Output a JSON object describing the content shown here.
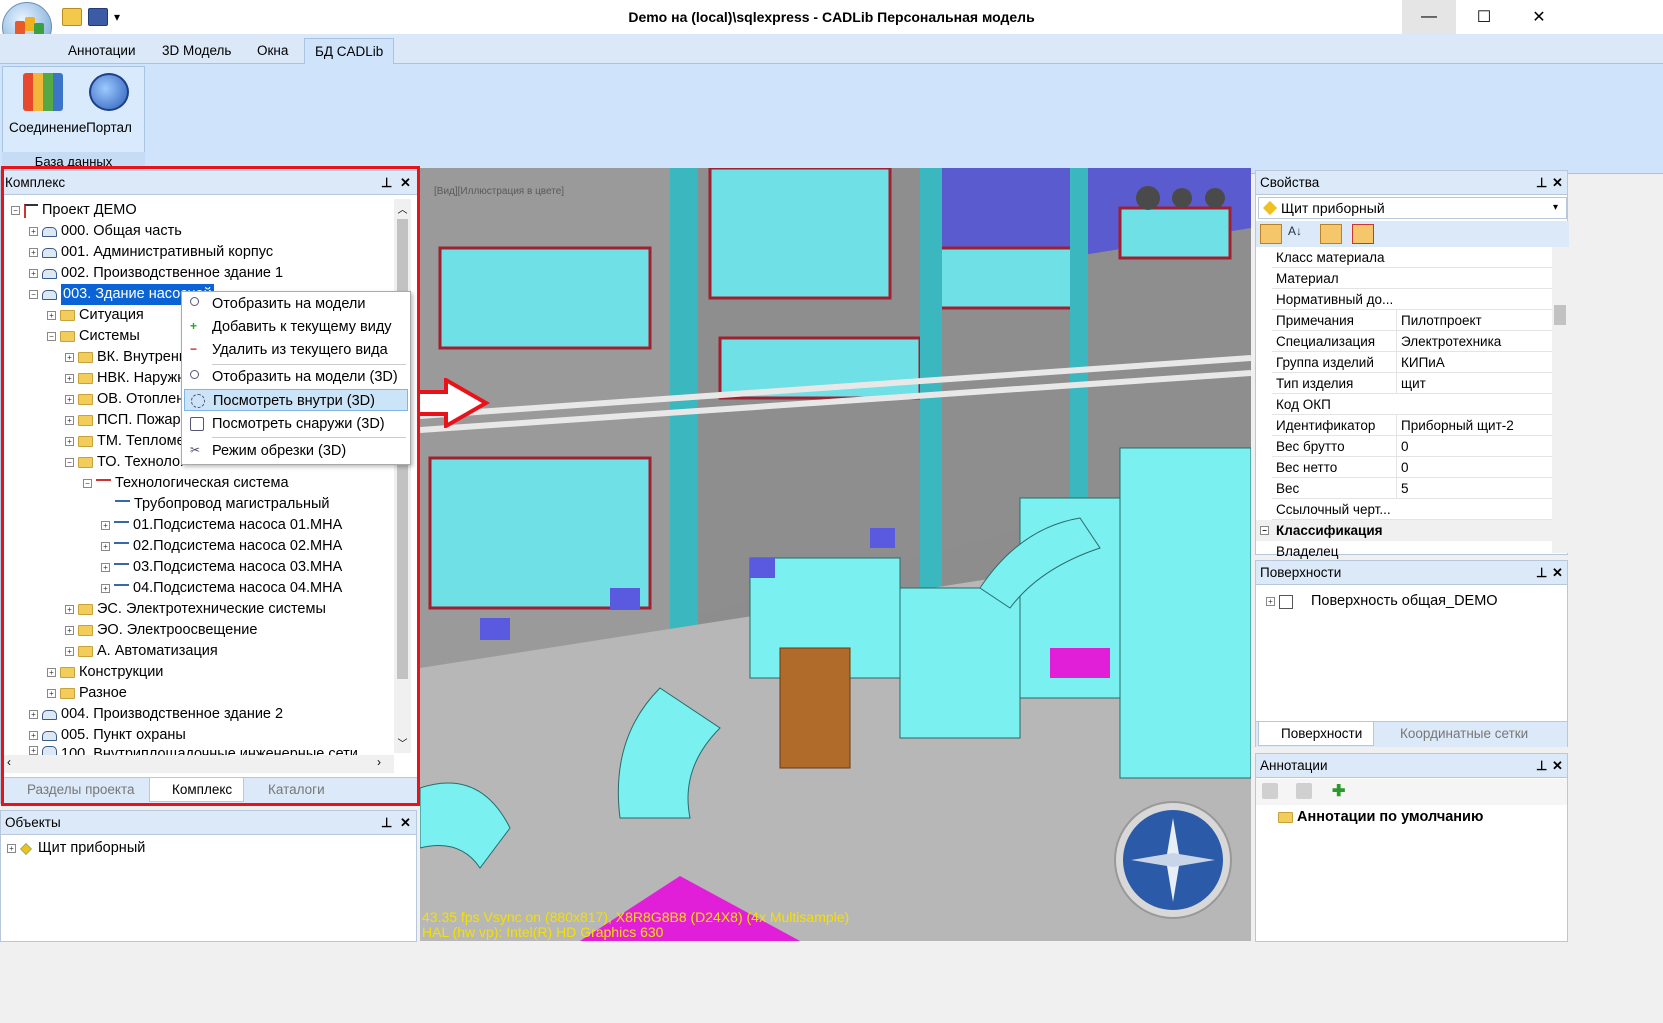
{
  "window": {
    "title": "Demo на (local)\\sqlexpress - CADLib Персональная модель",
    "minimize_glyph": "—",
    "maximize_glyph": "☐",
    "close_glyph": "✕"
  },
  "quick_access": {
    "dropdown_glyph": "▾"
  },
  "ribbon": {
    "tabs": [
      "Аннотации",
      "3D Модель",
      "Окна",
      "БД CADLib"
    ],
    "active_tab": "БД CADLib",
    "group_label": "База данных",
    "buttons": [
      "Соединение",
      "Портал"
    ]
  },
  "complex_panel": {
    "title": "Комплекс",
    "tree": [
      "Проект ДЕМО",
      "000. Общая часть",
      "001. Административный корпус",
      "002. Производственное здание 1",
      "003. Здание насосной",
      "Ситуация",
      "Системы",
      "ВК. Внутренн",
      "НВК. Наружн",
      "ОВ. Отоплен",
      "ПСП. Пожар",
      "ТМ. Тепломе",
      "ТО. Технолог",
      "Технологическая система",
      "Трубопровод магистральный",
      "01.Подсистема насоса 01.МНА",
      "02.Подсистема насоса 02.МНА",
      "03.Подсистема насоса 03.МНА",
      "04.Подсистема насоса 04.МНА",
      "ЭС. Электротехнические системы",
      "ЭО. Электроосвещение",
      "А. Автоматизация",
      "Конструкции",
      "Разное",
      "004. Производственное здание 2",
      "005. Пункт охраны",
      "100. Внутриплощадочные инженерные сети"
    ],
    "bottom_tabs": [
      "Разделы проекта",
      "Комплекс",
      "Каталоги"
    ]
  },
  "context_menu": {
    "items": [
      "Отобразить на модели",
      "Добавить к текущему виду",
      "Удалить из текущего вида",
      "Отобразить на модели (3D)",
      "Посмотреть внутри (3D)",
      "Посмотреть снаружи (3D)",
      "Режим обрезки (3D)"
    ],
    "highlighted": "Посмотреть внутри (3D)"
  },
  "objects_panel": {
    "title": "Объекты",
    "tree": [
      "Щит приборный"
    ]
  },
  "viewport": {
    "view_label": "[Вид][Иллюстрация в цвете]",
    "stats_line1": "43.35 fps Vsync on (880x817), X8R8G8B8 (D24X8) (4x Multisample)",
    "stats_line2": "HAL (hw vp): Intel(R) HD Graphics 630",
    "arrow_color": "#e8131a"
  },
  "properties_panel": {
    "title": "Свойства",
    "selected_object": "Щит приборный",
    "rows": [
      {
        "key": "Класс материала",
        "value": ""
      },
      {
        "key": "Материал",
        "value": ""
      },
      {
        "key": "Нормативный до...",
        "value": ""
      },
      {
        "key": "Примечания",
        "value": "Пилотпроект"
      },
      {
        "key": "Специализация",
        "value": "Электротехника"
      },
      {
        "key": "Группа изделий",
        "value": "КИПиА"
      },
      {
        "key": "Тип изделия",
        "value": "щит"
      },
      {
        "key": "Код ОКП",
        "value": ""
      },
      {
        "key": "Идентификатор",
        "value": "Приборный щит-2"
      },
      {
        "key": "Вес брутто",
        "value": "0"
      },
      {
        "key": "Вес нетто",
        "value": "0"
      },
      {
        "key": "Вес",
        "value": "5"
      },
      {
        "key": "Ссылочный черт...",
        "value": ""
      }
    ],
    "category": "Классификация",
    "after_category": {
      "key": "Владелец",
      "value": ""
    }
  },
  "surfaces_panel": {
    "title": "Поверхности",
    "items": [
      "Поверхность общая_DEMO"
    ],
    "bottom_tabs": [
      "Поверхности",
      "Координатные сетки"
    ]
  },
  "annotations_panel": {
    "title": "Аннотации",
    "items": [
      "Аннотации по умолчанию"
    ]
  }
}
